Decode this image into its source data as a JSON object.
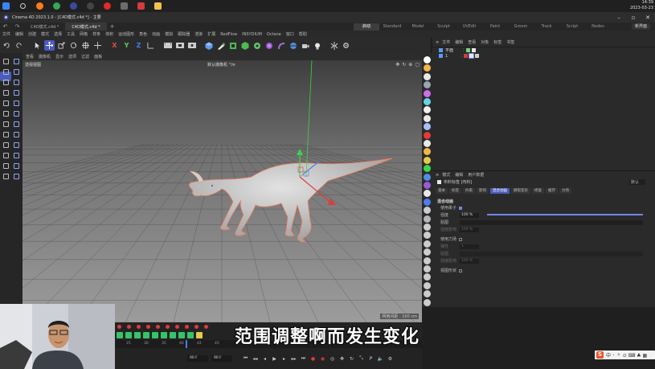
{
  "taskbar": {
    "apps": [
      {
        "name": "windows-start",
        "color": "#3a86ff"
      },
      {
        "name": "search",
        "color": "#cfcfcf"
      },
      {
        "name": "firefox",
        "color": "#ff7b1a"
      },
      {
        "name": "chrome",
        "color": "#34a853"
      },
      {
        "name": "cinema4d",
        "color": "#3b4a9c"
      },
      {
        "name": "obs",
        "color": "#444444"
      },
      {
        "name": "netease-music",
        "color": "#e22b2b"
      },
      {
        "name": "obs-studio",
        "color": "#6c6c6c"
      },
      {
        "name": "pinned-red",
        "color": "#d73a3a"
      },
      {
        "name": "folder",
        "color": "#f2c14e"
      }
    ],
    "time": "14:39",
    "date": "2023-03-23"
  },
  "titlebar": {
    "title": "Cinema 4D 2023.1.0 - [C4D模式.c4d *] - 主要"
  },
  "doc_tabs": [
    {
      "label": "C4D模式.c4d *",
      "active": false
    },
    {
      "label": "C4D模式.c4d *",
      "active": true
    }
  ],
  "layouts": [
    {
      "label": "启动",
      "active": true
    },
    {
      "label": "Standard",
      "active": false
    },
    {
      "label": "Model",
      "active": false
    },
    {
      "label": "Sculpt",
      "active": false
    },
    {
      "label": "UVEdit",
      "active": false
    },
    {
      "label": "Paint",
      "active": false
    },
    {
      "label": "Groom",
      "active": false
    },
    {
      "label": "Track",
      "active": false
    },
    {
      "label": "Script",
      "active": false
    },
    {
      "label": "Nodes",
      "active": false
    }
  ],
  "new_ui_label": "新界面",
  "menu": [
    "文件",
    "编辑",
    "创建",
    "模式",
    "选择",
    "工具",
    "网格",
    "样条",
    "体积",
    "运动图形",
    "角色",
    "动画",
    "模拟",
    "跟踪器",
    "渲染",
    "扩展",
    "RedFlow",
    "INSYDIUM",
    "Octane",
    "窗口",
    "帮助"
  ],
  "viewport": {
    "menu": [
      "查看",
      "摄像机",
      "显示",
      "选项",
      "过滤",
      "面板"
    ],
    "label": "透视视图",
    "camera": "默认摄像机 °/≡",
    "grid_info": "网格间距 : 100 cm"
  },
  "object_manager": {
    "header": [
      "文件",
      "编辑",
      "查看",
      "对象",
      "标签",
      "书签"
    ],
    "objects": [
      {
        "name": "平面"
      },
      {
        "name": "1"
      }
    ]
  },
  "attribute_manager": {
    "header": [
      "模式",
      "编辑",
      "用户数据"
    ],
    "title": "布料标签 [布料]",
    "preset": "默认",
    "tabs": [
      {
        "label": "基本",
        "active": false
      },
      {
        "label": "标签",
        "active": false
      },
      {
        "label": "约束",
        "active": false
      },
      {
        "label": "影响",
        "active": false
      },
      {
        "label": "混合动画",
        "active": true
      },
      {
        "label": "撕裂变形",
        "active": false
      },
      {
        "label": "修复",
        "active": false
      },
      {
        "label": "缓存",
        "active": false
      },
      {
        "label": "力场",
        "active": false
      }
    ],
    "section": "混合动画",
    "rows": [
      {
        "label": "使用柔子",
        "checked": true,
        "dim": false
      },
      {
        "label": "强度",
        "value": "100 %",
        "dim": false
      },
      {
        "label": "贴图",
        "value": "",
        "dim": false
      },
      {
        "label": "强度影响",
        "value": "100 %",
        "dim": true
      },
      {
        "label": "使用力场",
        "checked": false,
        "dim": false
      },
      {
        "label": "弹性",
        "value": "1",
        "dim": true
      },
      {
        "label": "贴图",
        "value": "",
        "dim": true
      },
      {
        "label": "强度影响",
        "value": "100 %",
        "dim": true
      },
      {
        "label": "视图形状",
        "checked": false,
        "dim": false
      }
    ],
    "strength_fraction": 1.0
  },
  "timeline": {
    "ruler": [
      "25",
      "30",
      "35",
      "40",
      "42",
      "45"
    ],
    "start_frame": "90 F",
    "end_frame": "90 F"
  },
  "subtitle": "范围调整啊而发生变化",
  "ime": {
    "logo": "S",
    "text": "中 ･ ⺀ ⊙ ⌨ ♣ ▦"
  }
}
